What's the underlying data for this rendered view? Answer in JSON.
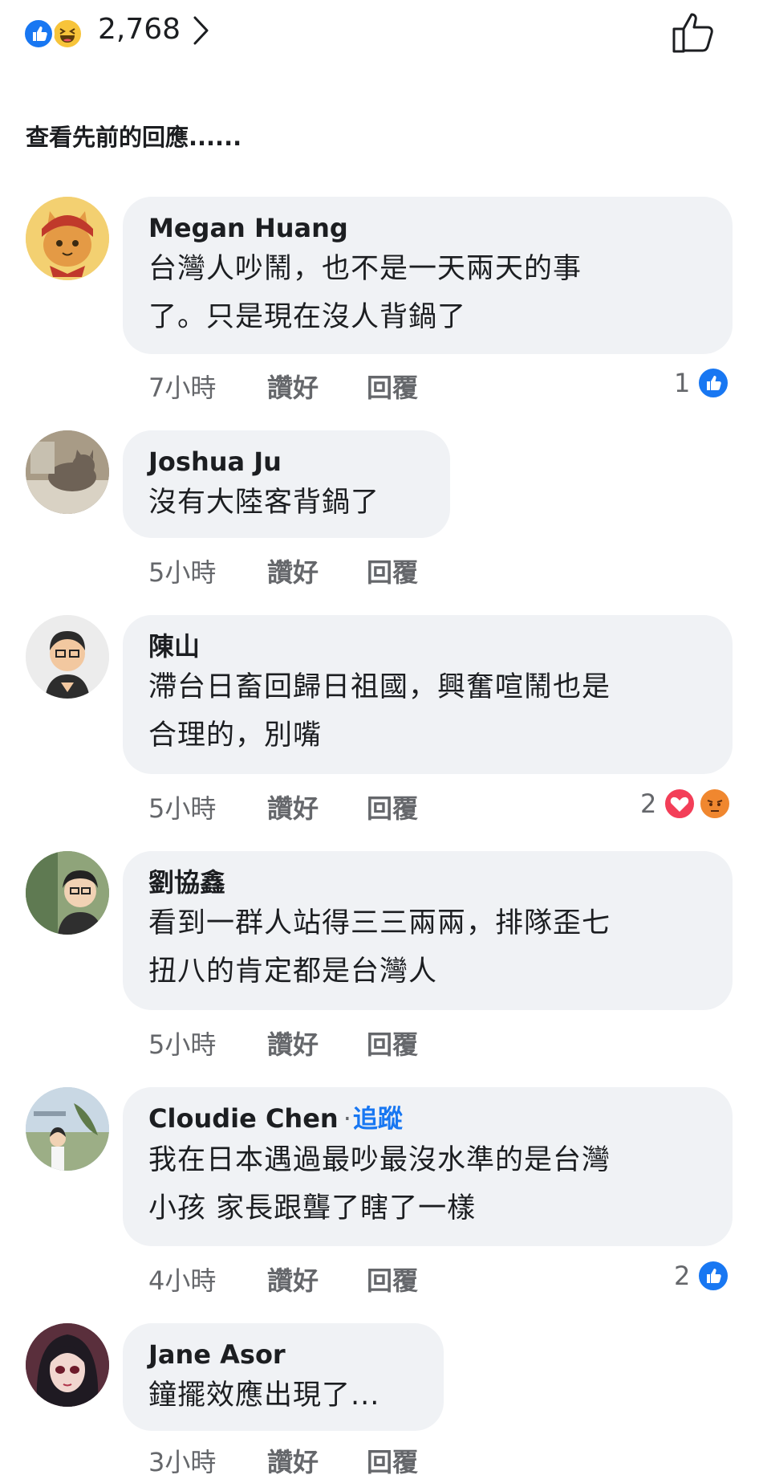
{
  "header": {
    "reactions": [
      "like",
      "haha"
    ],
    "reaction_count": "2,768",
    "chevron_icon": "chevron-right-icon",
    "like_icon": "thumbs-up-outline-icon"
  },
  "view_previous": "查看先前的回應......",
  "action_labels": {
    "like": "讚好",
    "reply": "回覆"
  },
  "follow_label": "追蹤",
  "comments": [
    {
      "name": "Megan Huang",
      "lines": [
        "台灣人吵鬧，也不是一天兩天的事",
        "了。只是現在沒人背鍋了"
      ],
      "time": "7小時",
      "reaction_count": "1",
      "reactions": [
        "like"
      ]
    },
    {
      "name": "Joshua Ju",
      "lines": [
        "沒有大陸客背鍋了"
      ],
      "time": "5小時",
      "reaction_count": "",
      "reactions": []
    },
    {
      "name": "陳山",
      "lines": [
        "滯台日畜回歸日祖國，興奮喧鬧也是",
        "合理的，別嘴"
      ],
      "time": "5小時",
      "reaction_count": "2",
      "reactions": [
        "love",
        "angry"
      ]
    },
    {
      "name": "劉協鑫",
      "lines": [
        "看到一群人站得三三兩兩，排隊歪七",
        "扭八的肯定都是台灣人"
      ],
      "time": "5小時",
      "reaction_count": "",
      "reactions": []
    },
    {
      "name": "Cloudie Chen",
      "lines": [
        "我在日本遇過最吵最沒水準的是台灣",
        "小孩 家長跟聾了瞎了一樣"
      ],
      "time": "4小時",
      "reaction_count": "2",
      "reactions": [
        "like"
      ]
    },
    {
      "name": "Jane Asor",
      "lines": [
        "鐘擺效應出現了..."
      ],
      "time": "3小時",
      "reaction_count": "",
      "reactions": []
    }
  ],
  "colors": {
    "accent": "#1877f2",
    "bubble": "#f0f2f5",
    "secondary_text": "#65676b",
    "love": "#f33e58",
    "angry": "#f0872f",
    "haha": "#f7c43a"
  }
}
